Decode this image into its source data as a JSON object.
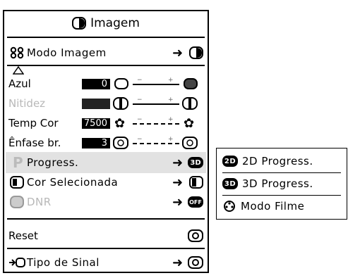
{
  "menu": {
    "title": "Imagem",
    "mode_label": "Modo Imagem",
    "rows": {
      "azul": {
        "label": "Azul",
        "value": "0"
      },
      "nitidez": {
        "label": "Nitidez"
      },
      "temp_cor": {
        "label": "Temp Cor",
        "value": "7500"
      },
      "enfase": {
        "label": "Ênfase br.",
        "value": "3"
      },
      "progress": {
        "label": "Progress."
      },
      "cor_sel": {
        "label": "Cor Selecionada"
      },
      "dnr": {
        "label": "DNR"
      },
      "reset": {
        "label": "Reset"
      },
      "sinal": {
        "label": "Tipo de Sinal"
      }
    },
    "slider_marks": {
      "minus": "−",
      "plus": "+"
    },
    "badges": {
      "progress": "3D",
      "dnr": "OFF",
      "p": "P"
    }
  },
  "submenu": {
    "items": [
      {
        "badge": "2D",
        "label": "2D Progress."
      },
      {
        "badge": "3D",
        "label": "3D Progress."
      },
      {
        "label": "Modo Filme"
      }
    ]
  }
}
